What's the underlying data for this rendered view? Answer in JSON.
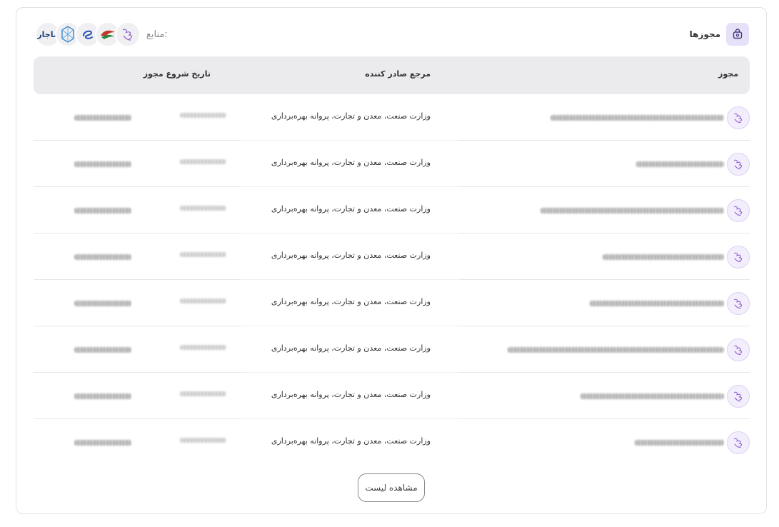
{
  "header": {
    "title": "مجوزها",
    "title_icon": "license-bag-icon",
    "sources_label": "منابع:",
    "sources": [
      "ministry-logo",
      "bird-logo",
      "e-logo",
      "network-logo",
      "ماجار"
    ]
  },
  "table": {
    "columns": {
      "license": "مجوز",
      "issuer": "مرجع صادر کننده",
      "start_date": "تاریخ شروع مجوز"
    },
    "rows": [
      {
        "issuer": "وزارت صنعت، معدن و تجارت، پروانه بهره‌برداری"
      },
      {
        "issuer": "وزارت صنعت، معدن و تجارت، پروانه بهره‌برداری"
      },
      {
        "issuer": "وزارت صنعت، معدن و تجارت، پروانه بهره‌برداری"
      },
      {
        "issuer": "وزارت صنعت، معدن و تجارت، پروانه بهره‌برداری"
      },
      {
        "issuer": "وزارت صنعت، معدن و تجارت، پروانه بهره‌برداری"
      },
      {
        "issuer": "وزارت صنعت، معدن و تجارت، پروانه بهره‌برداری"
      },
      {
        "issuer": "وزارت صنعت، معدن و تجارت، پروانه بهره‌برداری"
      },
      {
        "issuer": "وزارت صنعت، معدن و تجارت، پروانه بهره‌برداری"
      }
    ]
  },
  "footer": {
    "view_list_label": "مشاهده لیست"
  },
  "colors": {
    "accent_purple": "#7b4fc7",
    "header_bg": "#ebebee",
    "icon_bg": "#e6e0f8"
  }
}
